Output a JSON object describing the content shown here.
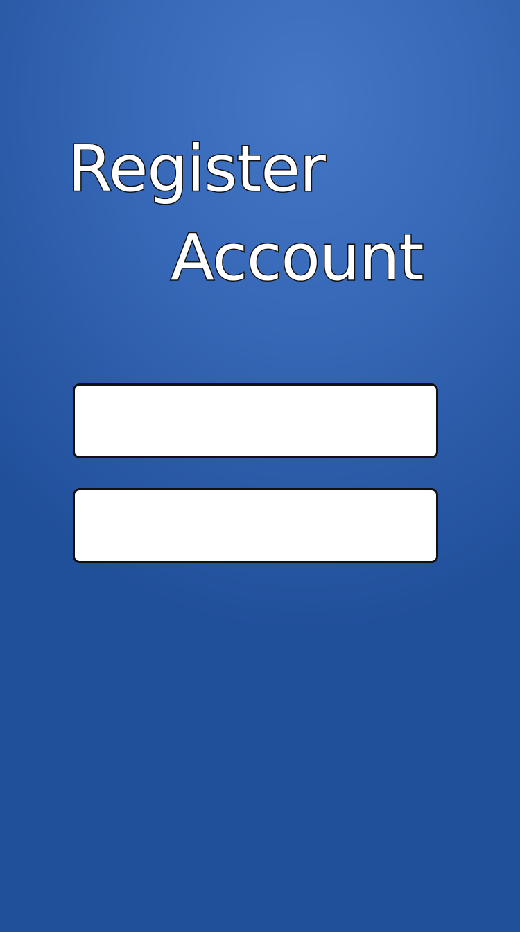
{
  "screen": {
    "title_line1": "Register",
    "title_line2": "Account"
  },
  "form": {
    "field_1": {
      "value": "",
      "placeholder": ""
    },
    "field_2": {
      "value": "",
      "placeholder": ""
    }
  },
  "colors": {
    "background_top": "#4376c5",
    "background_bottom": "#21509b",
    "field_fill": "#ffffff",
    "outline": "#111111",
    "title_fill": "#ffffff"
  }
}
